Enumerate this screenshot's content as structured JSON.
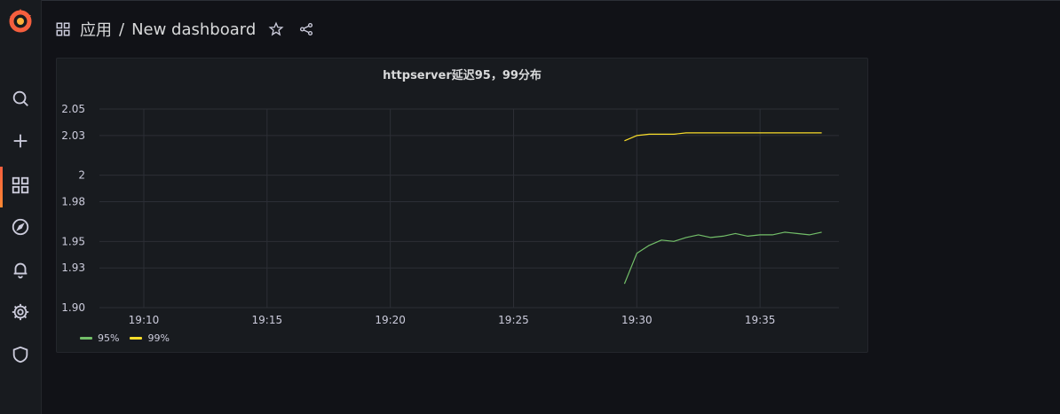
{
  "header": {
    "folder": "应用",
    "separator": "/",
    "title": "New dashboard"
  },
  "sidebar": {
    "items": [
      {
        "icon": "search-icon"
      },
      {
        "icon": "plus-icon"
      },
      {
        "icon": "dashboards-icon",
        "active": true
      },
      {
        "icon": "compass-icon"
      },
      {
        "icon": "bell-icon"
      },
      {
        "icon": "gear-icon"
      },
      {
        "icon": "shield-icon"
      }
    ]
  },
  "colors": {
    "accent": "#f55f3e",
    "series_95": "#73bf69",
    "series_99": "#fade2a",
    "grid": "#2c2f36",
    "text": "#ccccdc"
  },
  "panel": {
    "title": "httpserver延迟95，99分布"
  },
  "chart_data": {
    "type": "line",
    "title": "httpserver延迟95，99分布",
    "grid": true,
    "legend_position": "bottom-left",
    "ylim": [
      1.9,
      2.05
    ],
    "y_ticks": [
      "2.05",
      "2.03",
      "2",
      "1.98",
      "1.95",
      "1.93",
      "1.90"
    ],
    "y_tick_values": [
      2.05,
      2.03,
      2.0,
      1.98,
      1.95,
      1.93,
      1.9
    ],
    "x_ticks": [
      "19:10",
      "19:15",
      "19:20",
      "19:25",
      "19:30",
      "19:35"
    ],
    "x_tick_minutes": [
      10,
      15,
      20,
      25,
      30,
      35
    ],
    "xlim_minutes": [
      8.2,
      38.2
    ],
    "x_unit": "minutes past 19:00",
    "series": [
      {
        "name": "95%",
        "color": "#73bf69",
        "x": [
          29.5,
          30.0,
          30.5,
          31.0,
          31.5,
          32.0,
          32.5,
          33.0,
          33.5,
          34.0,
          34.5,
          35.0,
          35.5,
          36.0,
          36.5,
          37.0,
          37.5
        ],
        "y": [
          1.918,
          1.941,
          1.947,
          1.951,
          1.95,
          1.953,
          1.955,
          1.953,
          1.954,
          1.956,
          1.954,
          1.955,
          1.955,
          1.957,
          1.956,
          1.955,
          1.957
        ]
      },
      {
        "name": "99%",
        "color": "#fade2a",
        "x": [
          29.5,
          30.0,
          30.5,
          31.0,
          31.5,
          32.0,
          32.5,
          33.0,
          33.5,
          34.0,
          34.5,
          35.0,
          35.5,
          36.0,
          36.5,
          37.0,
          37.5
        ],
        "y": [
          2.026,
          2.03,
          2.031,
          2.031,
          2.031,
          2.032,
          2.032,
          2.032,
          2.032,
          2.032,
          2.032,
          2.032,
          2.032,
          2.032,
          2.032,
          2.032,
          2.032
        ]
      }
    ]
  }
}
